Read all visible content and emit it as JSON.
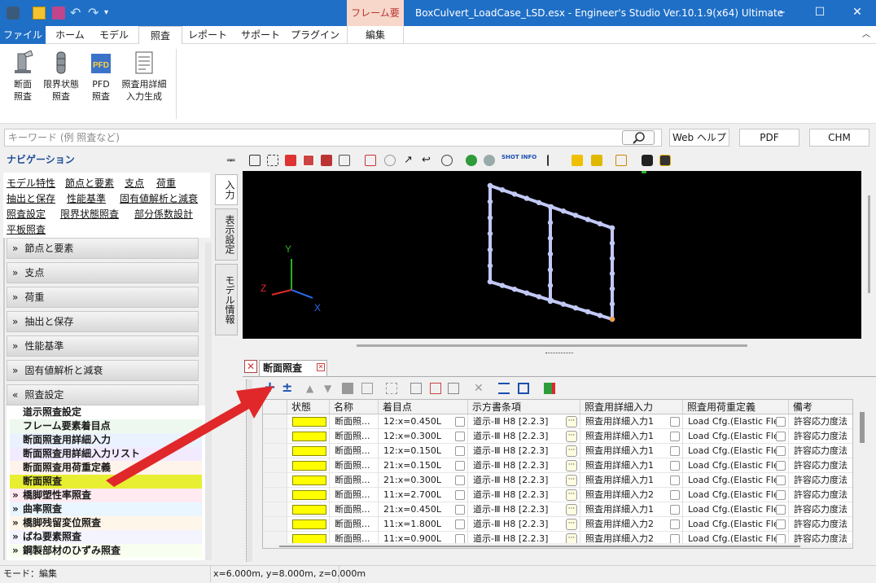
{
  "app": {
    "title": "BoxCulvert_LoadCase_LSD.esx - Engineer's Studio Ver.10.1.9(x64) Ultimate",
    "context_tab": "フレーム要素",
    "context_subtab": "編集"
  },
  "window_buttons": {
    "minimize": "–",
    "maximize": "☐",
    "close": "✕"
  },
  "menu": [
    "ファイル",
    "ホーム",
    "モデル",
    "照査",
    "レポート",
    "サポート",
    "プラグイン"
  ],
  "ribbon": [
    {
      "line1": "断面",
      "line2": "照査",
      "icon": "section-check-icon"
    },
    {
      "line1": "限界状態",
      "line2": "照査",
      "icon": "limit-state-icon"
    },
    {
      "line1": "PFD",
      "line2": "照査",
      "icon": "pfd-icon"
    },
    {
      "line1": "照査用詳細",
      "line2": "入力生成",
      "icon": "detail-input-icon"
    }
  ],
  "pfd_icon_text": "PFD",
  "search": {
    "placeholder": "キーワード (例 照査など)"
  },
  "help_buttons": [
    "Web ヘルプ",
    "PDF",
    "CHM"
  ],
  "nav": {
    "title": "ナビゲーション",
    "pin": "ᆍ",
    "links": [
      "モデル特性",
      "節点と要素",
      "支点",
      "荷重",
      "抽出と保存",
      "性能基準",
      "固有値解析と減衰",
      "照査設定",
      "限界状態照査",
      "部分係数設計",
      "平板照査"
    ],
    "vtabs": [
      "入力",
      "表示設定",
      "モデル情報"
    ],
    "categories": [
      {
        "label": "節点と要素",
        "icon": "»"
      },
      {
        "label": "支点",
        "icon": "»"
      },
      {
        "label": "荷重",
        "icon": "»"
      },
      {
        "label": "抽出と保存",
        "icon": "»"
      },
      {
        "label": "性能基準",
        "icon": "»"
      },
      {
        "label": "固有値解析と減衰",
        "icon": "»"
      },
      {
        "label": "照査設定",
        "icon": "«"
      }
    ],
    "sub_items": [
      {
        "label": "道示照査設定",
        "bg": "#ffffff",
        "mark": ""
      },
      {
        "label": "フレーム要素着目点",
        "bg": "#eef8ee",
        "mark": ""
      },
      {
        "label": "断面照査用詳細入力",
        "bg": "#eaf2ff",
        "mark": ""
      },
      {
        "label": "断面照査用詳細入力リスト",
        "bg": "#f2eaff",
        "mark": ""
      },
      {
        "label": "断面照査用荷重定義",
        "bg": "#fff4ec",
        "mark": ""
      },
      {
        "label": "断面照査",
        "bg": "#e8ee32",
        "mark": ""
      },
      {
        "label": "橋脚塑性率照査",
        "bg": "#ffeaf2",
        "mark": "»"
      },
      {
        "label": "曲率照査",
        "bg": "#eaf6ff",
        "mark": "»"
      },
      {
        "label": "橋脚残留変位照査",
        "bg": "#fff6ea",
        "mark": "»"
      },
      {
        "label": "ばね要素照査",
        "bg": "#f4f4ff",
        "mark": "»"
      },
      {
        "label": "鋼製部材のひずみ照査",
        "bg": "#f8fff0",
        "mark": "»"
      }
    ]
  },
  "view_toolbar": {
    "shot_label": "SHOT",
    "info_label": "INFO"
  },
  "axes": {
    "x": "X",
    "y": "Y",
    "z": "Z"
  },
  "panel": {
    "tab_title": "断面照査"
  },
  "grid": {
    "columns": [
      "状態",
      "名称",
      "着目点",
      "示方書条項",
      "照査用詳細入力",
      "照査用荷重定義",
      "備考"
    ],
    "rows": [
      {
        "name": "断面照...",
        "point": "12:x=0.450L",
        "clause": "道示-Ⅲ H8 [2.2.3]",
        "detail": "照査用詳細入力1",
        "load": "Load Cfg.(Elastic Fle",
        "note": "許容応力度法"
      },
      {
        "name": "断面照...",
        "point": "12:x=0.300L",
        "clause": "道示-Ⅲ H8 [2.2.3]",
        "detail": "照査用詳細入力1",
        "load": "Load Cfg.(Elastic Fle",
        "note": "許容応力度法"
      },
      {
        "name": "断面照...",
        "point": "12:x=0.150L",
        "clause": "道示-Ⅲ H8 [2.2.3]",
        "detail": "照査用詳細入力1",
        "load": "Load Cfg.(Elastic Fle",
        "note": "許容応力度法"
      },
      {
        "name": "断面照...",
        "point": "21:x=0.150L",
        "clause": "道示-Ⅲ H8 [2.2.3]",
        "detail": "照査用詳細入力1",
        "load": "Load Cfg.(Elastic Fle",
        "note": "許容応力度法"
      },
      {
        "name": "断面照...",
        "point": "21:x=0.300L",
        "clause": "道示-Ⅲ H8 [2.2.3]",
        "detail": "照査用詳細入力1",
        "load": "Load Cfg.(Elastic Fle",
        "note": "許容応力度法"
      },
      {
        "name": "断面照...",
        "point": "11:x=2.700L",
        "clause": "道示-Ⅲ H8 [2.2.3]",
        "detail": "照査用詳細入力2",
        "load": "Load Cfg.(Elastic Fle",
        "note": "許容応力度法"
      },
      {
        "name": "断面照...",
        "point": "21:x=0.450L",
        "clause": "道示-Ⅲ H8 [2.2.3]",
        "detail": "照査用詳細入力1",
        "load": "Load Cfg.(Elastic Fle",
        "note": "許容応力度法"
      },
      {
        "name": "断面照...",
        "point": "11:x=1.800L",
        "clause": "道示-Ⅲ H8 [2.2.3]",
        "detail": "照査用詳細入力2",
        "load": "Load Cfg.(Elastic Fle",
        "note": "許容応力度法"
      },
      {
        "name": "断面照...",
        "point": "11:x=0.900L",
        "clause": "道示-Ⅲ H8 [2.2.3]",
        "detail": "照査用詳細入力2",
        "load": "Load Cfg.(Elastic Fle",
        "note": "許容応力度法"
      }
    ]
  },
  "status": {
    "mode": "モード：編集",
    "coords": "x=6.000m, y=8.000m, z=0.000m"
  },
  "colors": {
    "title_bar": "#1f6fc6",
    "accent_red": "#e0282a",
    "status_yellow": "#ffff00",
    "viewport_bg": "#000000",
    "model_lines": "#c3c9f5"
  }
}
